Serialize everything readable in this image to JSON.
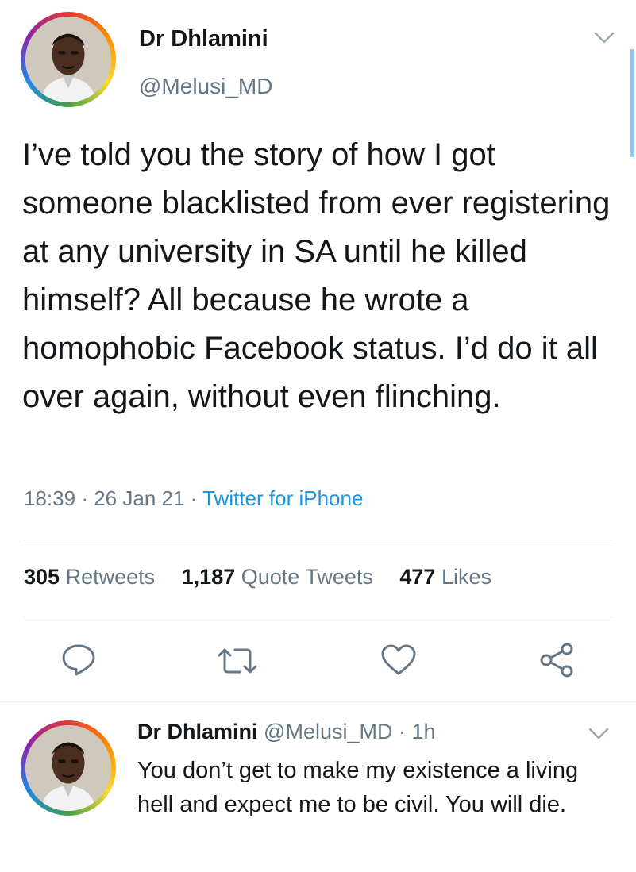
{
  "tweet": {
    "display_name": "Dr Dhlamini",
    "handle": "@Melusi_MD",
    "text": "I’ve told you the story of how I got someone blacklisted from ever registering at any university in SA until he killed himself? All because he wrote a homophobic Facebook status. I’d do it all over again, without even flinching.",
    "time": "18:39",
    "date": "26 Jan 21",
    "separator": "·",
    "source": "Twitter for iPhone"
  },
  "stats": {
    "retweets_count": "305",
    "retweets_label": "Retweets",
    "quotes_count": "1,187",
    "quotes_label": "Quote Tweets",
    "likes_count": "477",
    "likes_label": "Likes"
  },
  "actions": [
    "reply-icon",
    "retweet-icon",
    "like-icon",
    "share-icon"
  ],
  "reply": {
    "display_name": "Dr Dhlamini",
    "handle": "@Melusi_MD",
    "separator": "·",
    "age": "1h",
    "text": "You don’t get to make my existence a living hell and expect me to be civil. You will die."
  },
  "colors": {
    "text": "#14171a",
    "muted": "#657786",
    "link": "#1b95e0",
    "divider": "#e6ecf0",
    "scrollbar": "#8fc7f0"
  }
}
